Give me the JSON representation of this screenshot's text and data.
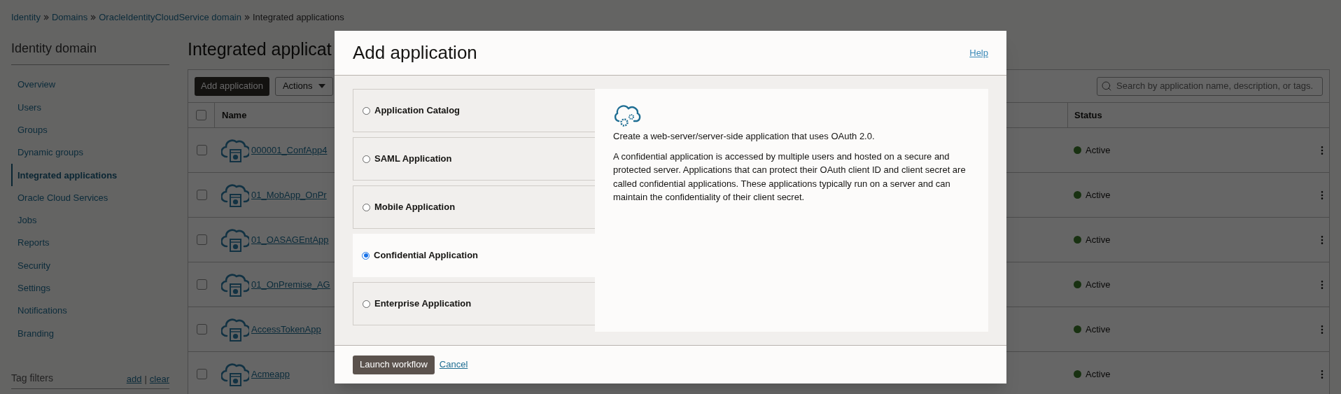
{
  "breadcrumb": [
    {
      "label": "Identity",
      "kind": "link"
    },
    {
      "label": "Domains",
      "kind": "link"
    },
    {
      "label": "OracleIdentityCloudService domain",
      "kind": "link"
    },
    {
      "label": "Integrated applications",
      "kind": "current"
    }
  ],
  "sidebar": {
    "title": "Identity domain",
    "items": [
      {
        "label": "Overview",
        "selected": false
      },
      {
        "label": "Users",
        "selected": false
      },
      {
        "label": "Groups",
        "selected": false
      },
      {
        "label": "Dynamic groups",
        "selected": false
      },
      {
        "label": "Integrated applications",
        "selected": true
      },
      {
        "label": "Oracle Cloud Services",
        "selected": false
      },
      {
        "label": "Jobs",
        "selected": false
      },
      {
        "label": "Reports",
        "selected": false
      },
      {
        "label": "Security",
        "selected": false
      },
      {
        "label": "Settings",
        "selected": false
      },
      {
        "label": "Notifications",
        "selected": false
      },
      {
        "label": "Branding",
        "selected": false
      }
    ],
    "tag_filters": {
      "label": "Tag filters",
      "add": "add",
      "separator": "|",
      "clear": "clear"
    }
  },
  "page_title": "Integrated applicat",
  "toolbar": {
    "add_button": "Add application",
    "actions_button": "Actions",
    "search": {
      "placeholder": "Search by application name, description, or tags."
    }
  },
  "table": {
    "columns": [
      "Name",
      "Status"
    ],
    "select_all_checked": false,
    "rows": [
      {
        "name": "000001_ConfApp4",
        "status": "Active",
        "checked": false
      },
      {
        "name": "01_MobApp_OnPr",
        "status": "Active",
        "checked": false
      },
      {
        "name": "01_OASAGEntApp",
        "status": "Active",
        "checked": false
      },
      {
        "name": "01_OnPremise_AG",
        "status": "Active",
        "checked": false
      },
      {
        "name": "AccessTokenApp",
        "status": "Active",
        "checked": false
      },
      {
        "name": "Acmeapp",
        "status": "Active",
        "checked": false
      }
    ]
  },
  "modal": {
    "title": "Add application",
    "help": "Help",
    "options": [
      {
        "label": "Application Catalog",
        "selected": false
      },
      {
        "label": "SAML Application",
        "selected": false
      },
      {
        "label": "Mobile Application",
        "selected": false
      },
      {
        "label": "Confidential Application",
        "selected": true
      },
      {
        "label": "Enterprise Application",
        "selected": false
      }
    ],
    "detail": {
      "summary": "Create a web-server/server-side application that uses OAuth 2.0.",
      "description": "A confidential application is accessed by multiple users and hosted on a secure and protected server. Applications that can protect their OAuth client ID and client secret are called confidential applications. These applications typically run on a server and can maintain the confidentiality of their client secret."
    },
    "launch_button": "Launch workflow",
    "cancel_link": "Cancel"
  }
}
